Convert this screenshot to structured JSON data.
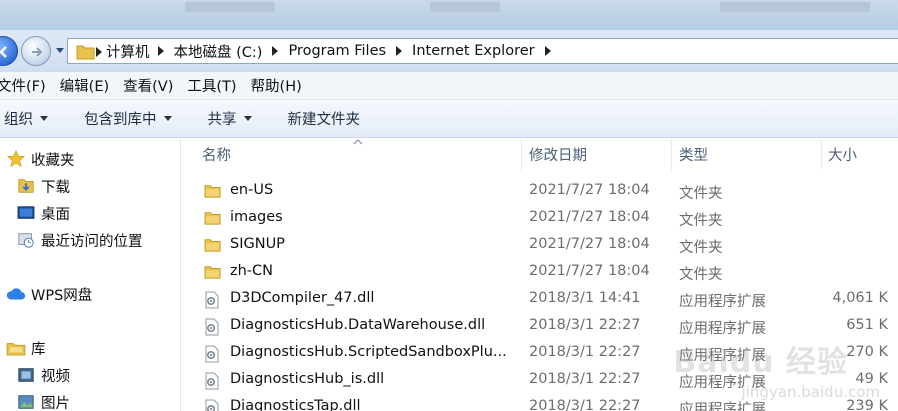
{
  "breadcrumbs": [
    "计算机",
    "本地磁盘 (C:)",
    "Program Files",
    "Internet Explorer"
  ],
  "menu": [
    "文件(F)",
    "编辑(E)",
    "查看(V)",
    "工具(T)",
    "帮助(H)"
  ],
  "toolbar": {
    "organize": "组织",
    "include_library": "包含到库中",
    "share": "共享",
    "new_folder": "新建文件夹"
  },
  "nav": {
    "favorites": "收藏夹",
    "downloads": "下载",
    "desktop": "桌面",
    "recent": "最近访问的位置",
    "wps": "WPS网盘",
    "libraries": "库",
    "videos": "视频",
    "pictures": "图片"
  },
  "columns": {
    "name": "名称",
    "date": "修改日期",
    "type": "类型",
    "size": "大小"
  },
  "files": [
    {
      "name": "en-US",
      "date": "2021/7/27 18:04",
      "type": "文件夹",
      "size": "",
      "icon": "folder"
    },
    {
      "name": "images",
      "date": "2021/7/27 18:04",
      "type": "文件夹",
      "size": "",
      "icon": "folder"
    },
    {
      "name": "SIGNUP",
      "date": "2021/7/27 18:04",
      "type": "文件夹",
      "size": "",
      "icon": "folder"
    },
    {
      "name": "zh-CN",
      "date": "2021/7/27 18:04",
      "type": "文件夹",
      "size": "",
      "icon": "folder"
    },
    {
      "name": "D3DCompiler_47.dll",
      "date": "2018/3/1 14:41",
      "type": "应用程序扩展",
      "size": "4,061 K",
      "icon": "dll"
    },
    {
      "name": "DiagnosticsHub.DataWarehouse.dll",
      "date": "2018/3/1 22:27",
      "type": "应用程序扩展",
      "size": "651 K",
      "icon": "dll"
    },
    {
      "name": "DiagnosticsHub.ScriptedSandboxPlu...",
      "date": "2018/3/1 22:27",
      "type": "应用程序扩展",
      "size": "270 K",
      "icon": "dll"
    },
    {
      "name": "DiagnosticsHub_is.dll",
      "date": "2018/3/1 22:27",
      "type": "应用程序扩展",
      "size": "49 K",
      "icon": "dll"
    },
    {
      "name": "DiagnosticsTap.dll",
      "date": "2018/3/1 22:27",
      "type": "应用程序扩展",
      "size": "239 K",
      "icon": "dll"
    }
  ],
  "watermark": {
    "brand": "Baidu 经验",
    "url": "jingyan.baidu.com"
  },
  "colors": {
    "folder": "#e8c04d",
    "header_bg": "#dfe9f5",
    "accent": "#2f6fd6"
  }
}
